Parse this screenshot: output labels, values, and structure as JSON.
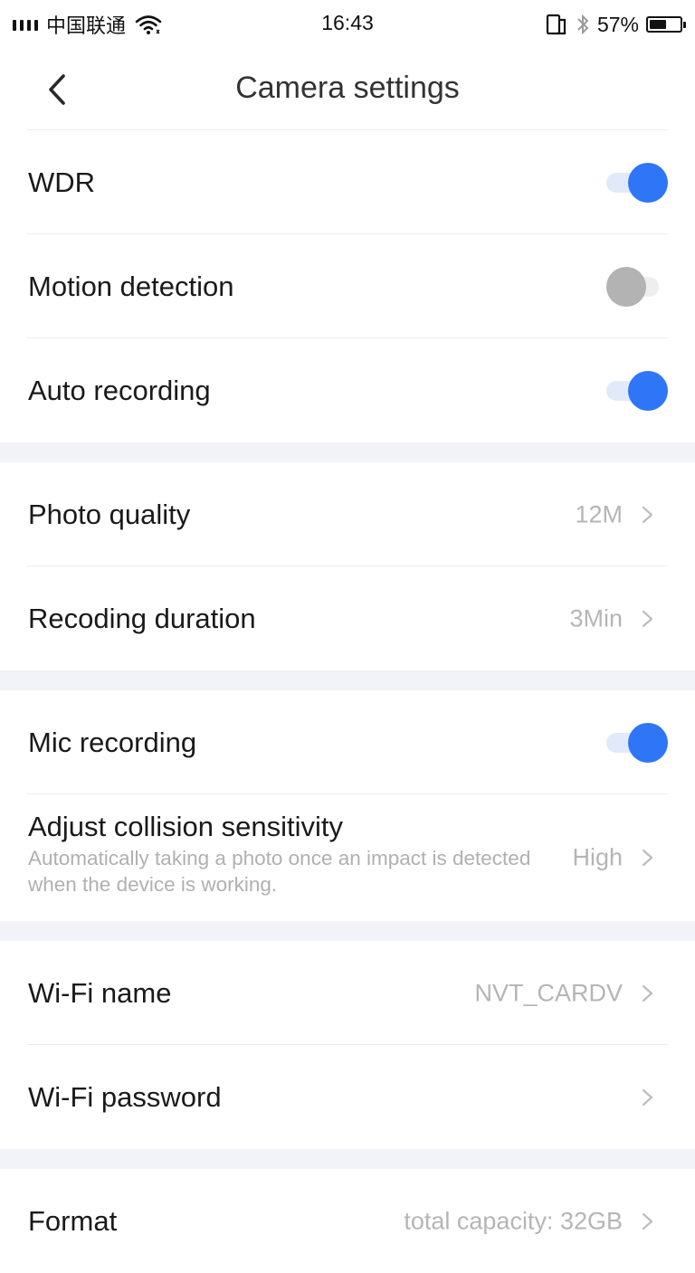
{
  "status_bar": {
    "carrier": "中国联通",
    "time": "16:43",
    "battery_percent": "57%",
    "battery_level": 0.57,
    "icons": [
      "signal-icon",
      "wifi-icon",
      "dual-screen-icon",
      "bluetooth-icon",
      "battery-icon"
    ]
  },
  "header": {
    "title": "Camera settings",
    "back_icon": "chevron-left-icon"
  },
  "colors": {
    "accent": "#2f76f6",
    "toggle_on_track": "#e1eafb",
    "toggle_off_knob": "#b3b3b3",
    "value_text": "#b5b5b5",
    "section_gap": "#f1f3f8"
  },
  "sections": [
    {
      "rows": [
        {
          "label": "WDR",
          "toggle": true
        },
        {
          "label": "Motion detection",
          "toggle": false
        },
        {
          "label": "Auto recording",
          "toggle": true
        }
      ]
    },
    {
      "rows": [
        {
          "label": "Photo quality",
          "value": "12M"
        },
        {
          "label": "Recoding duration",
          "value": "3Min"
        }
      ]
    },
    {
      "rows": [
        {
          "label": "Mic recording",
          "toggle": true
        },
        {
          "label": "Adjust collision sensitivity",
          "description": "Automatically taking a photo once an impact is detected when the device is working.",
          "value": "High"
        }
      ]
    },
    {
      "rows": [
        {
          "label": "Wi-Fi name",
          "value": "NVT_CARDV"
        },
        {
          "label": "Wi-Fi password",
          "value": ""
        }
      ]
    },
    {
      "rows": [
        {
          "label": "Format",
          "value": "total capacity: 32GB"
        }
      ]
    }
  ]
}
